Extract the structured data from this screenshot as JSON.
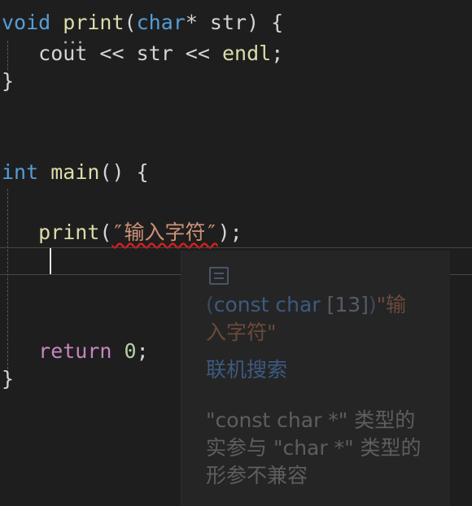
{
  "code": {
    "line1": {
      "kw": "void",
      "fn": "print",
      "open": "(",
      "type": "char",
      "rest": "* str) {"
    },
    "line2": {
      "ind": "   ",
      "id1": "cout",
      "op1": " << ",
      "id2": "str",
      "op2": " << ",
      "fn": "endl",
      "semi": ";"
    },
    "line3": "}",
    "line4": {
      "kw": "int",
      "sp": " ",
      "fn": "main",
      "rest": "() {"
    },
    "line5": {
      "ind": "   ",
      "fn": "print",
      "open": "(",
      "str": "″输入字符″",
      "close": ");"
    },
    "line6": {
      "ind": "   ",
      "ctl": "return",
      "sp": " ",
      "num": "0",
      "semi": ";"
    },
    "line7": "}"
  },
  "hover": {
    "sig_open": "(",
    "sig_type": "const char",
    "sig_len": " [13]",
    "sig_close": ")",
    "sig_literal": "\"输入字符\"",
    "search": "联机搜索",
    "error": "\"const char *\" 类型的实参与 \"char *\" 类型的形参不兼容"
  },
  "colors": {
    "background": "#1e1e1e",
    "keyword": "#569cd6",
    "function": "#dcdcaa",
    "control": "#c586c0",
    "number": "#b5cea8",
    "string": "#ce9178",
    "error_squiggle": "#e01b1b"
  },
  "icons": [
    "signature-icon"
  ]
}
